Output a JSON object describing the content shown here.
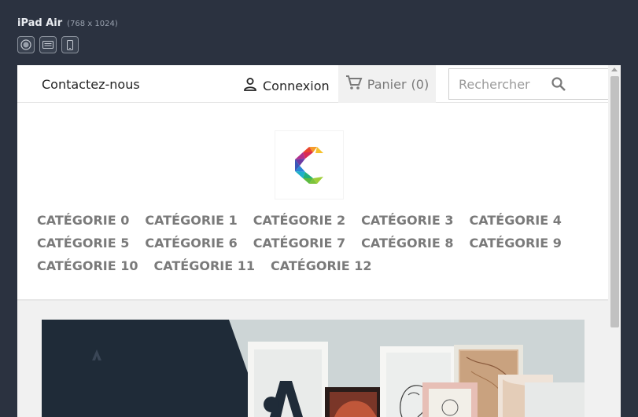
{
  "device": {
    "name": "iPad Air",
    "size": "(768 x 1024)",
    "icons": [
      "touch-icon",
      "keyboard-icon",
      "phone-icon"
    ]
  },
  "header": {
    "contact_label": "Contactez-nous",
    "login_label": "Connexion",
    "cart_label": "Panier",
    "cart_count": "(0)",
    "search_placeholder": "Rechercher"
  },
  "menu": {
    "items": [
      "CATÉGORIE 0",
      "CATÉGORIE 1",
      "CATÉGORIE 2",
      "CATÉGORIE 3",
      "CATÉGORIE 4",
      "CATÉGORIE 5",
      "CATÉGORIE 6",
      "CATÉGORIE 7",
      "CATÉGORIE 8",
      "CATÉGORIE 9",
      "CATÉGORIE 10",
      "CATÉGORIE 11",
      "CATÉGORIE 12"
    ]
  },
  "colors": {
    "background": "#2b3240",
    "menu_text": "#7a7a7a",
    "cart_bg": "#f1f1f1",
    "banner_dark": "#1f2b38"
  }
}
